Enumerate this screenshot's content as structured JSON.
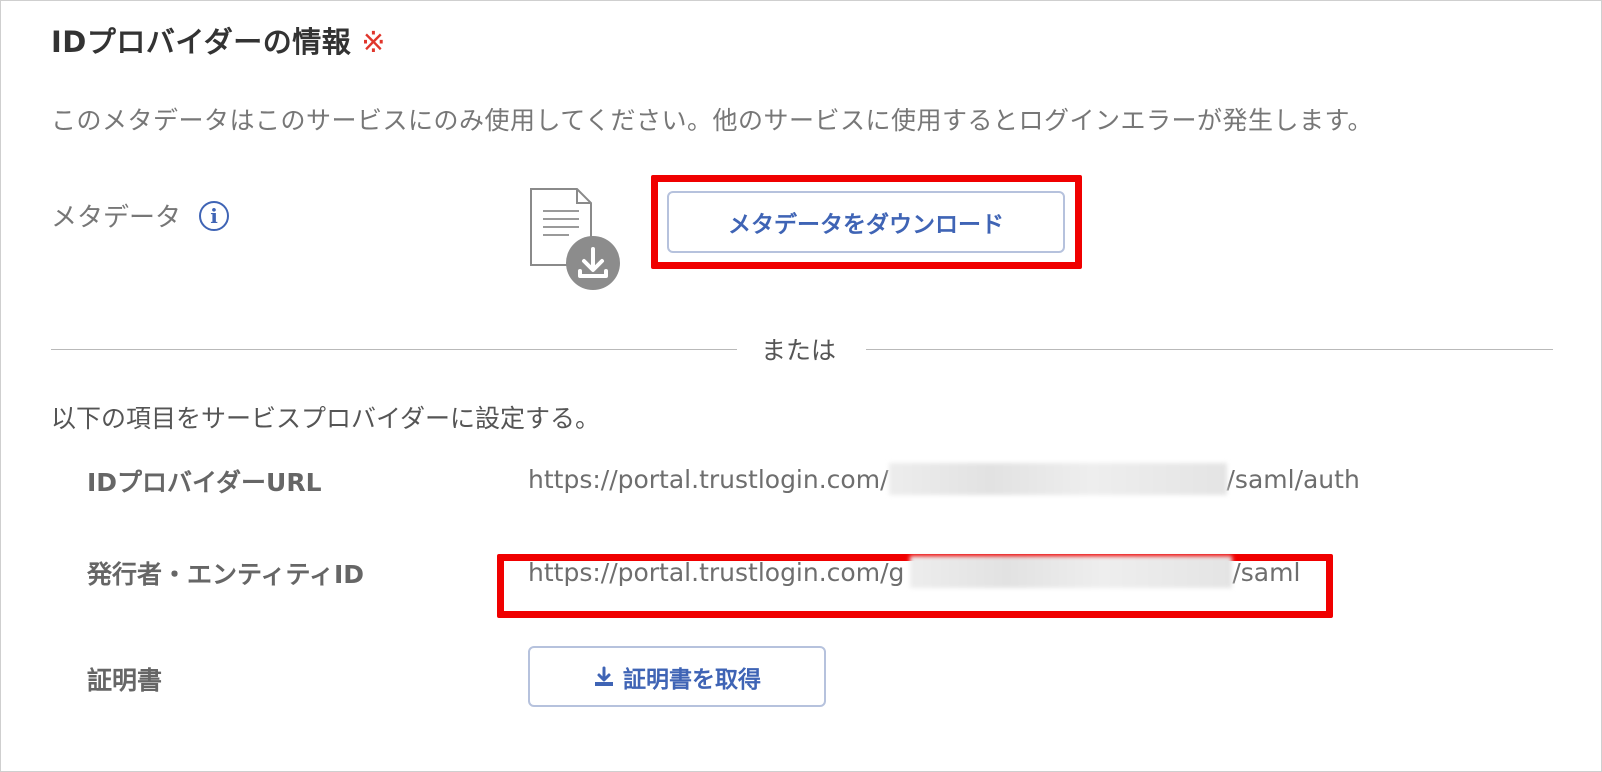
{
  "section": {
    "title": "IDプロバイダーの情報",
    "required_mark": "※",
    "description": "このメタデータはこのサービスにのみ使用してください。他のサービスに使用するとログインエラーが発生します。"
  },
  "metadata": {
    "label": "メタデータ",
    "info_icon": "info-icon",
    "file_icon": "document-download-icon",
    "download_button": "メタデータをダウンロード"
  },
  "divider": {
    "or_text": "または"
  },
  "manual": {
    "instruction": "以下の項目をサービスプロバイダーに設定する。",
    "rows": [
      {
        "label": "IDプロバイダーURL",
        "value_prefix": "https://portal.trustlogin.com/",
        "value_suffix": "/saml/auth"
      },
      {
        "label": "発行者・エンティティID",
        "value_prefix": "https://portal.trustlogin.com/g",
        "value_suffix": "/saml"
      }
    ],
    "certificate": {
      "label": "証明書",
      "button": "証明書を取得",
      "icon": "download-icon"
    }
  },
  "colors": {
    "accent": "#3f64b5",
    "highlight": "#f00000",
    "required": "#e0362c"
  }
}
